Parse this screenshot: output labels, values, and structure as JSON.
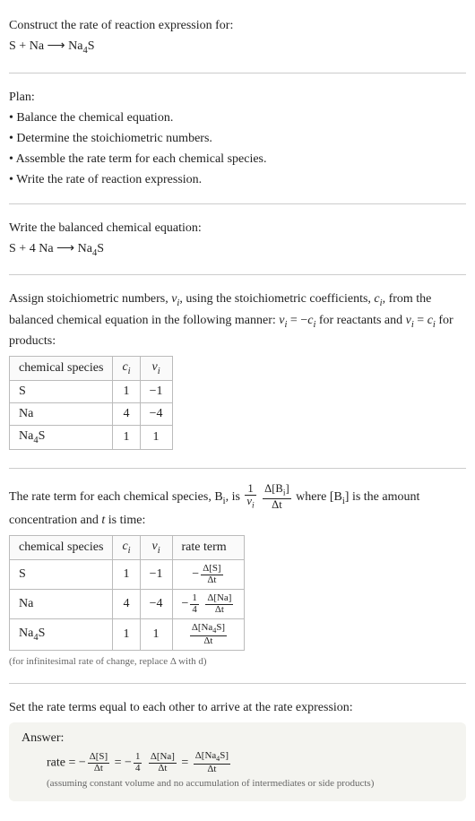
{
  "header": {
    "title": "Construct the rate of reaction expression for:",
    "equation_lhs1": "S",
    "equation_plus1": " + ",
    "equation_lhs2": "Na",
    "equation_arrow": " ⟶ ",
    "equation_rhs_na": "Na",
    "equation_rhs_sub": "4",
    "equation_rhs_s": "S"
  },
  "plan": {
    "title": "Plan:",
    "items": [
      "• Balance the chemical equation.",
      "• Determine the stoichiometric numbers.",
      "• Assemble the rate term for each chemical species.",
      "• Write the rate of reaction expression."
    ]
  },
  "balanced": {
    "title": "Write the balanced chemical equation:",
    "lhs1": "S",
    "plus": " + ",
    "coef": "4 ",
    "lhs2": "Na",
    "arrow": " ⟶ ",
    "rhs_na": "Na",
    "rhs_sub": "4",
    "rhs_s": "S"
  },
  "assign": {
    "text_p1": "Assign stoichiometric numbers, ",
    "nu": "ν",
    "sub_i": "i",
    "text_p2": ", using the stoichiometric coefficients, ",
    "c": "c",
    "text_p3": ", from the balanced chemical equation in the following manner: ",
    "eq1_lhs_nu": "ν",
    "eq1_eq": " = −",
    "eq1_rhs_c": "c",
    "text_p4": " for reactants and ",
    "eq2_eq": " = ",
    "text_p5": " for products:"
  },
  "table1": {
    "headers": {
      "col1": "chemical species",
      "col2_c": "c",
      "col2_i": "i",
      "col3_nu": "ν",
      "col3_i": "i"
    },
    "rows": [
      {
        "species": "S",
        "species_sub": "",
        "c": "1",
        "nu": "−1"
      },
      {
        "species": "Na",
        "species_sub": "",
        "c": "4",
        "nu": "−4"
      },
      {
        "species": "Na",
        "species_sub": "4",
        "species_tail": "S",
        "c": "1",
        "nu": "1"
      }
    ]
  },
  "rateterm_intro": {
    "p1": "The rate term for each chemical species, B",
    "sub_i": "i",
    "p2": ", is ",
    "frac_pre_top": "1",
    "frac_pre_bot_nu": "ν",
    "frac_pre_bot_i": "i",
    "frac_main_top": "Δ[B",
    "frac_main_top_i": "i",
    "frac_main_top_close": "]",
    "frac_main_bot": "Δt",
    "p3": " where [B",
    "p4": "] is the amount concentration and ",
    "t_var": "t",
    "p5": " is time:"
  },
  "table2": {
    "headers": {
      "col1": "chemical species",
      "col2_c": "c",
      "col2_i": "i",
      "col3_nu": "ν",
      "col3_i": "i",
      "col4": "rate term"
    },
    "rows": [
      {
        "species": "S",
        "species_sub": "",
        "species_tail": "",
        "c": "1",
        "nu": "−1",
        "rate_prefix_top": "",
        "rate_prefix_bot": "",
        "rate_sign": "−",
        "rate_top": "Δ[S]",
        "rate_bot": "Δt"
      },
      {
        "species": "Na",
        "species_sub": "",
        "species_tail": "",
        "c": "4",
        "nu": "−4",
        "rate_prefix_top": "1",
        "rate_prefix_bot": "4",
        "rate_sign": "−",
        "rate_top": "Δ[Na]",
        "rate_bot": "Δt"
      },
      {
        "species": "Na",
        "species_sub": "4",
        "species_tail": "S",
        "c": "1",
        "nu": "1",
        "rate_prefix_top": "",
        "rate_prefix_bot": "",
        "rate_sign": "",
        "rate_top_p1": "Δ[Na",
        "rate_top_sub": "4",
        "rate_top_p2": "S]",
        "rate_bot": "Δt"
      }
    ]
  },
  "inf_note": "(for infinitesimal rate of change, replace Δ with d)",
  "set_equal": "Set the rate terms equal to each other to arrive at the rate expression:",
  "answer": {
    "title": "Answer:",
    "rate_label": "rate = ",
    "neg1": "−",
    "f1_top": "Δ[S]",
    "f1_bot": "Δt",
    "eq": " = ",
    "neg2": "−",
    "pre2_top": "1",
    "pre2_bot": "4",
    "f2_top": "Δ[Na]",
    "f2_bot": "Δt",
    "f3_top_p1": "Δ[Na",
    "f3_top_sub": "4",
    "f3_top_p2": "S]",
    "f3_bot": "Δt",
    "note": "(assuming constant volume and no accumulation of intermediates or side products)"
  }
}
